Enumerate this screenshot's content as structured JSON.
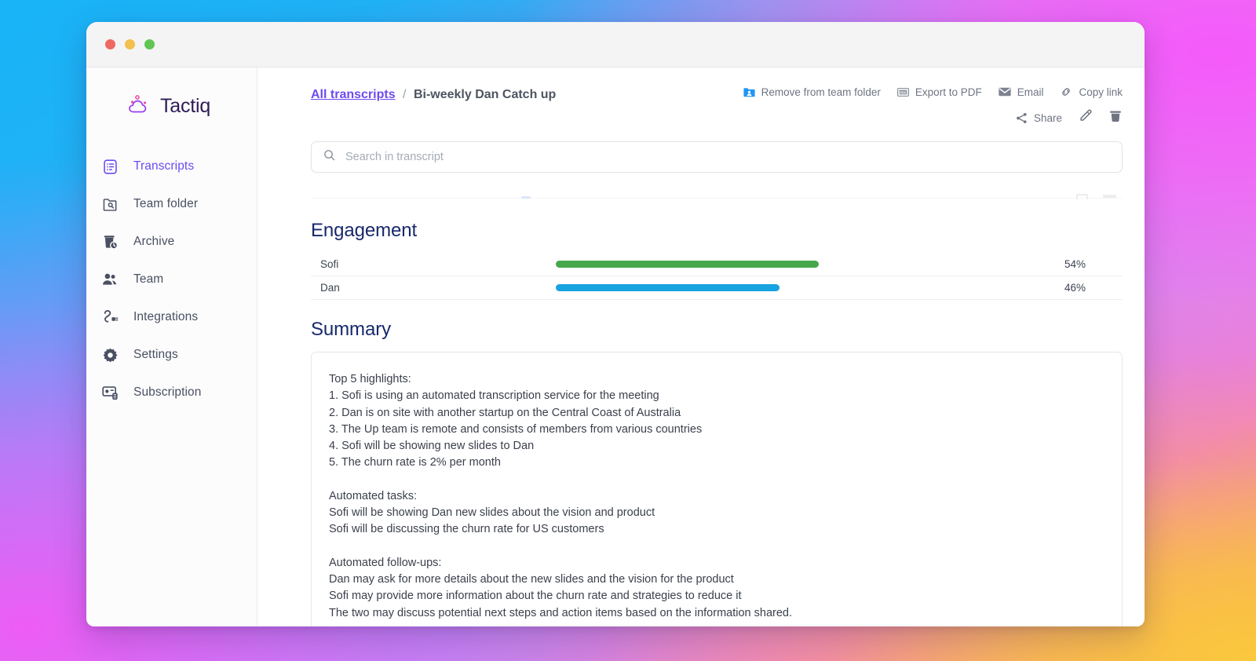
{
  "window": {
    "traffic_lights": [
      "close",
      "minimize",
      "maximize"
    ]
  },
  "brand": {
    "name": "Tactiq",
    "logo_icon": "tactiq-cloud-logo"
  },
  "sidebar": {
    "items": [
      {
        "label": "Transcripts",
        "icon": "document-list-icon",
        "active": true
      },
      {
        "label": "Team folder",
        "icon": "folder-search-icon",
        "active": false
      },
      {
        "label": "Archive",
        "icon": "archive-clock-icon",
        "active": false
      },
      {
        "label": "Team",
        "icon": "people-icon",
        "active": false
      },
      {
        "label": "Integrations",
        "icon": "plug-icon",
        "active": false
      },
      {
        "label": "Settings",
        "icon": "gear-icon",
        "active": false
      },
      {
        "label": "Subscription",
        "icon": "credit-card-icon",
        "active": false
      }
    ]
  },
  "breadcrumb": {
    "root_label": "All transcripts",
    "separator": "/",
    "current_label": "Bi-weekly Dan Catch up"
  },
  "actions": {
    "primary_row": [
      {
        "label": "Remove from team folder",
        "icon": "folder-person-icon"
      },
      {
        "label": "Export to PDF",
        "icon": "pdf-icon"
      },
      {
        "label": "Email",
        "icon": "envelope-icon"
      },
      {
        "label": "Copy link",
        "icon": "link-icon"
      }
    ],
    "secondary_row": [
      {
        "label": "Share",
        "icon": "share-icon"
      },
      {
        "label": "",
        "icon": "pencil-edit-icon"
      },
      {
        "label": "",
        "icon": "trash-delete-icon"
      }
    ]
  },
  "search": {
    "placeholder": "Search in transcript",
    "value": "",
    "icon": "search-icon"
  },
  "engagement": {
    "title": "Engagement",
    "rows": [
      {
        "name": "Sofi",
        "percent_label": "54%",
        "percent": 54,
        "color": "#46a74c"
      },
      {
        "name": "Dan",
        "percent_label": "46%",
        "percent": 46,
        "color": "#17a2e0"
      }
    ]
  },
  "chart_data": {
    "type": "bar",
    "title": "Engagement",
    "categories": [
      "Sofi",
      "Dan"
    ],
    "values": [
      54,
      46
    ],
    "value_labels": [
      "54%",
      "46%"
    ],
    "colors": [
      "#46a74c",
      "#17a2e0"
    ],
    "xlabel": "",
    "ylabel": "",
    "xlim": [
      0,
      100
    ],
    "orientation": "horizontal",
    "grid": false,
    "legend": "none"
  },
  "summary": {
    "title": "Summary",
    "lines": [
      "Top 5 highlights:",
      "1. Sofi is using an automated transcription service for the meeting",
      "2. Dan is on site with another startup on the Central Coast of Australia",
      "3. The Up team is remote and consists of members from various countries",
      "4. Sofi will be showing new slides to Dan",
      "5. The churn rate is 2% per month",
      "",
      "Automated tasks:",
      "Sofi will be showing Dan new slides about the vision and product",
      "Sofi will be discussing the churn rate for US customers",
      "",
      "Automated follow-ups:",
      "Dan may ask for more details about the new slides and the vision for the product",
      "Sofi may provide more information about the churn rate and strategies to reduce it",
      "The two may discuss potential next steps and action items based on the information shared."
    ]
  },
  "colors": {
    "accent_purple": "#6d4bf0",
    "heading_navy": "#18286b",
    "bar_green": "#46a74c",
    "bar_blue": "#17a2e0"
  }
}
